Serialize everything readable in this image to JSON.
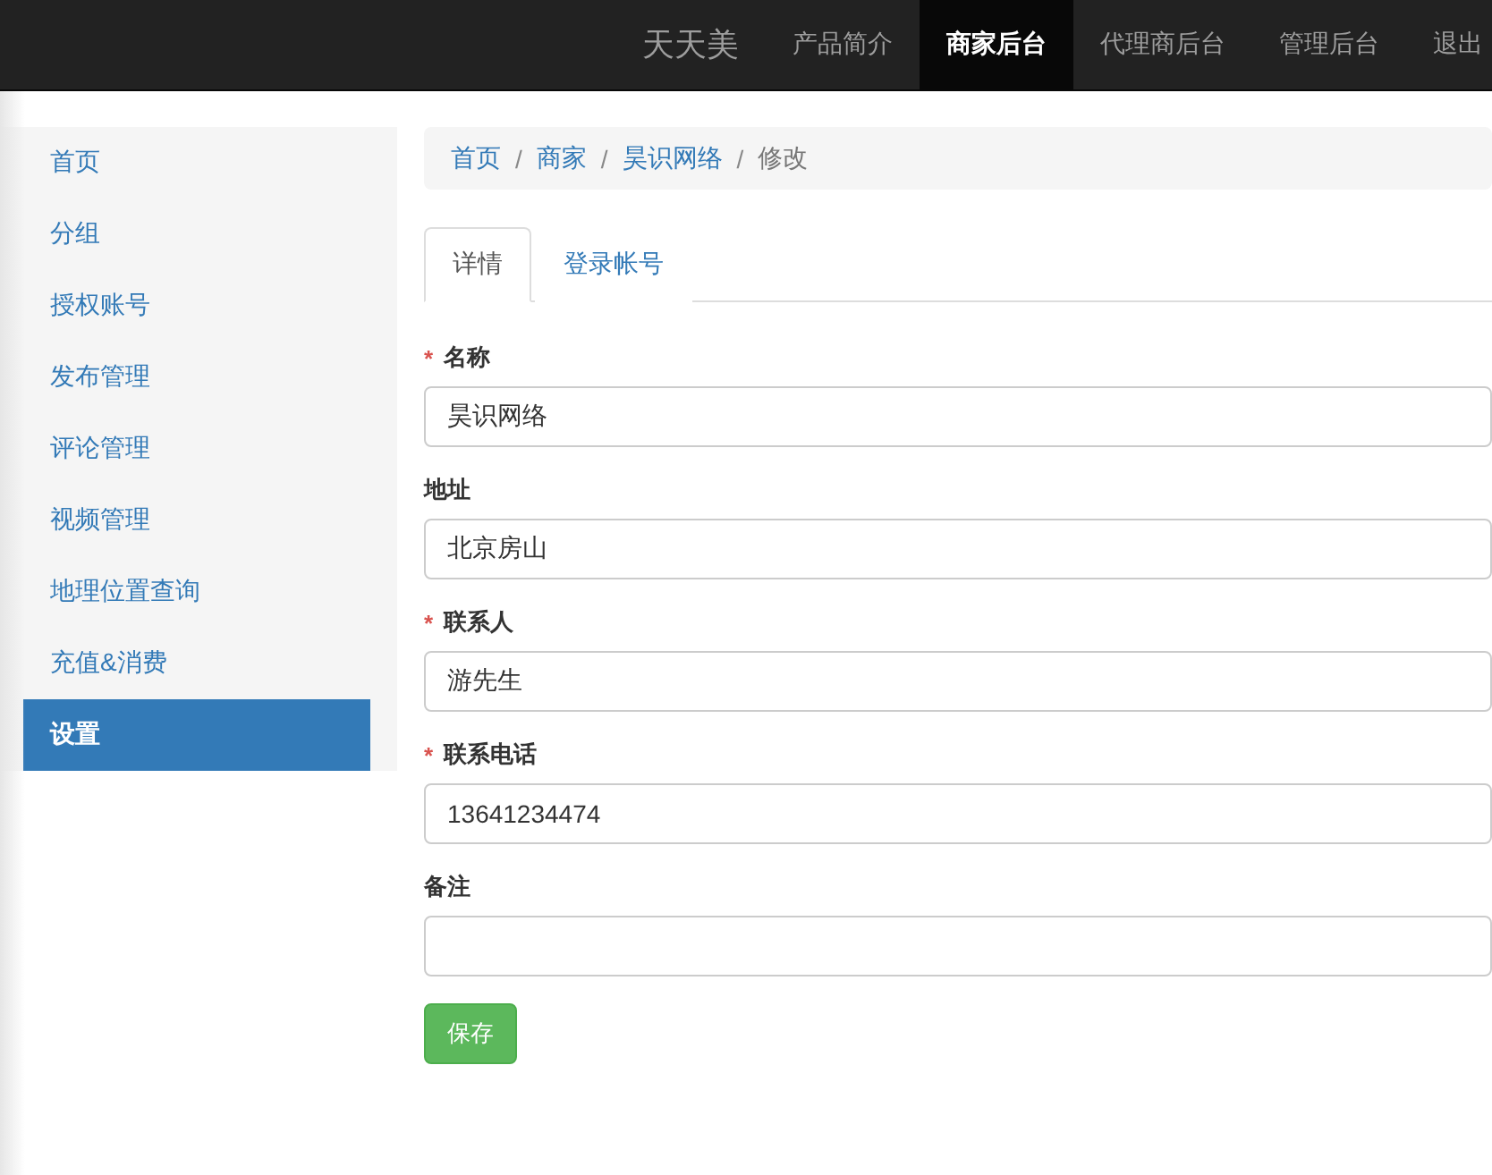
{
  "navbar": {
    "brand": "天天美",
    "items": [
      {
        "label": "产品简介",
        "selected": false
      },
      {
        "label": "商家后台",
        "selected": true
      },
      {
        "label": "代理商后台",
        "selected": false
      },
      {
        "label": "管理后台",
        "selected": false
      },
      {
        "label": "退出",
        "selected": false
      }
    ]
  },
  "sidebar": {
    "items": [
      {
        "label": "首页",
        "selected": false
      },
      {
        "label": "分组",
        "selected": false
      },
      {
        "label": "授权账号",
        "selected": false
      },
      {
        "label": "发布管理",
        "selected": false
      },
      {
        "label": "评论管理",
        "selected": false
      },
      {
        "label": "视频管理",
        "selected": false
      },
      {
        "label": "地理位置查询",
        "selected": false
      },
      {
        "label": "充值&消费",
        "selected": false
      },
      {
        "label": "设置",
        "selected": true
      }
    ]
  },
  "breadcrumb": {
    "links": [
      "首页",
      "商家",
      "昊识网络"
    ],
    "separator": "/",
    "current": "修改"
  },
  "tabs": [
    {
      "label": "详情",
      "selected": true
    },
    {
      "label": "登录帐号",
      "selected": false
    }
  ],
  "form": {
    "fields": [
      {
        "label": "名称",
        "required": true,
        "value": "昊识网络"
      },
      {
        "label": "地址",
        "required": false,
        "value": "北京房山"
      },
      {
        "label": "联系人",
        "required": true,
        "value": "游先生"
      },
      {
        "label": "联系电话",
        "required": true,
        "value": "13641234474"
      },
      {
        "label": "备注",
        "required": false
      }
    ],
    "required_mark": "*",
    "submit": "保存"
  }
}
